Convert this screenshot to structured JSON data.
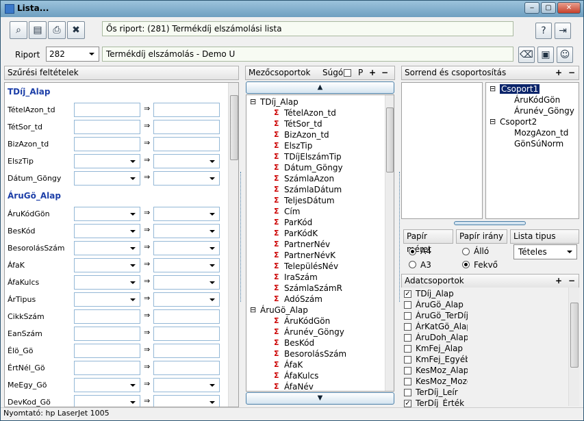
{
  "window": {
    "title": "Lista...",
    "min": "‒",
    "max": "▢",
    "close": "✕"
  },
  "toolbar": {
    "source_report": "Ős riport: (281)  Termékdíj elszámolási lista"
  },
  "riport": {
    "label": "Riport",
    "number": "282",
    "name": "Termékdíj elszámolás - Demo U"
  },
  "filters": {
    "header": "Szűrési feltételek",
    "groups": [
      {
        "title": "TDíj_Alap",
        "rows": [
          {
            "label": "TételAzon_td",
            "type": "text"
          },
          {
            "label": "TétSor_td",
            "type": "text"
          },
          {
            "label": "BizAzon_td",
            "type": "text"
          },
          {
            "label": "ElszTip",
            "type": "select"
          },
          {
            "label": "Dátum_Göngy",
            "type": "select"
          }
        ]
      },
      {
        "title": "ÁruGö_Alap",
        "rows": [
          {
            "label": "ÁruKódGön",
            "type": "select"
          },
          {
            "label": "BesKód",
            "type": "select"
          },
          {
            "label": "BesorolásSzám",
            "type": "select"
          },
          {
            "label": "ÁfaK",
            "type": "select"
          },
          {
            "label": "ÁfaKulcs",
            "type": "select"
          },
          {
            "label": "ÁrTipus",
            "type": "select"
          },
          {
            "label": "CikkSzám",
            "type": "text"
          },
          {
            "label": "EanSzám",
            "type": "text"
          },
          {
            "label": "Élö_Gö",
            "type": "text"
          },
          {
            "label": "ÉrtNél_Gö",
            "type": "text"
          },
          {
            "label": "MeEgy_Gö",
            "type": "select"
          },
          {
            "label": "DevKod_Gö",
            "type": "select"
          }
        ]
      }
    ],
    "arrow": "⇒"
  },
  "fields": {
    "header": "Mezőcsoportok",
    "help": "Súgó",
    "p": "P",
    "plus": "+",
    "minus": "−",
    "groups": [
      {
        "name": "TDíj_Alap",
        "items": [
          "TételAzon_td",
          "TétSor_td",
          "BizAzon_td",
          "ElszTip",
          "TDíjElszámTip",
          "Dátum_Göngy",
          "SzámlaAzon",
          "SzámlaDátum",
          "TeljesDátum",
          "Cím",
          "ParKód",
          "ParKódK",
          "PartnerNév",
          "PartnerNévK",
          "TelepülésNév",
          "IraSzám",
          "SzámlaSzámR",
          "AdóSzám"
        ]
      },
      {
        "name": "ÁruGö_Alap",
        "items": [
          "ÁruKódGön",
          "Árunév_Göngy",
          "BesKód",
          "BesorolásSzám",
          "ÁfaK",
          "ÁfaKulcs",
          "ÁfaNév"
        ]
      }
    ]
  },
  "sort": {
    "header": "Sorrend és csoportosítás",
    "plus": "+",
    "minus": "−",
    "groups": [
      {
        "name": "Csoport1",
        "items": [
          "ÁruKódGön",
          "Árunév_Göngy"
        ]
      },
      {
        "name": "Csoport2",
        "items": [
          "MozgAzon_td",
          "GönSúNorm"
        ]
      }
    ]
  },
  "paper": {
    "size_label": "Papír méret",
    "size_options": [
      "A4",
      "A3"
    ],
    "size_selected": "A4",
    "orient_label": "Papír irány",
    "orient_options": [
      "Álló",
      "Fekvő"
    ],
    "orient_selected": "Fekvő",
    "list_type_label": "Lista tipus",
    "list_type_value": "Tételes"
  },
  "datagroups": {
    "header": "Adatcsoportok",
    "plus": "+",
    "minus": "−",
    "items": [
      {
        "label": "TDíj_Alap",
        "checked": true
      },
      {
        "label": "ÁruGö_Alap",
        "checked": false
      },
      {
        "label": "ÁruGö_TerDíj",
        "checked": false
      },
      {
        "label": "ÁrKatGö_Alap",
        "checked": false
      },
      {
        "label": "ÁruDoh_Alap",
        "checked": false
      },
      {
        "label": "KmFej_Alap",
        "checked": false
      },
      {
        "label": "KmFej_Egyéb",
        "checked": false
      },
      {
        "label": "KesMoz_Alap",
        "checked": false
      },
      {
        "label": "KesMoz_Mozgá",
        "checked": false
      },
      {
        "label": "TerDíj_Leír",
        "checked": false
      },
      {
        "label": "TerDíj_Érték",
        "checked": true
      }
    ]
  },
  "status": {
    "printer": "Nyomtató: hp LaserJet 1005"
  }
}
